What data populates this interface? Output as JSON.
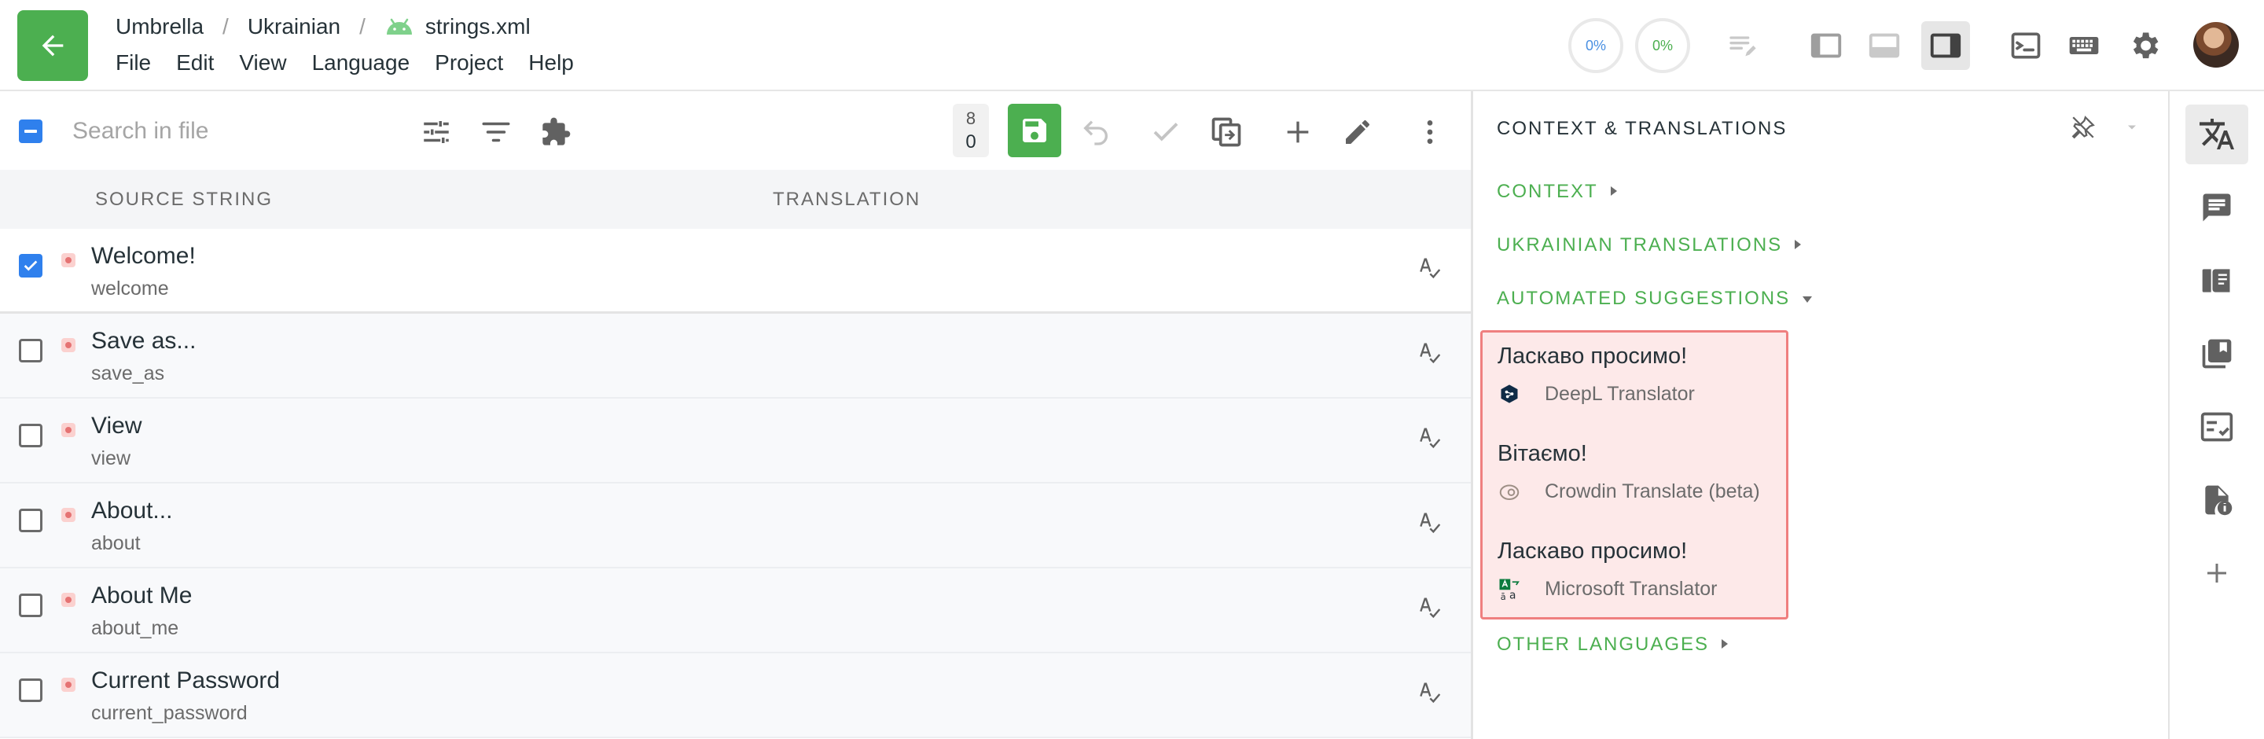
{
  "breadcrumb": {
    "project": "Umbrella",
    "separator": "/",
    "language": "Ukrainian",
    "file": "strings.xml"
  },
  "menu": [
    "File",
    "Edit",
    "View",
    "Language",
    "Project",
    "Help"
  ],
  "progress": {
    "translated": "0%",
    "approved": "0%"
  },
  "editor": {
    "search_placeholder": "Search in file",
    "counter_top": "8",
    "counter_bottom": "0",
    "columns": {
      "source": "SOURCE STRING",
      "translation": "TRANSLATION"
    },
    "rows": [
      {
        "text": "Welcome!",
        "key": "welcome",
        "checked": true
      },
      {
        "text": "Save as...",
        "key": "save_as",
        "checked": false
      },
      {
        "text": "View",
        "key": "view",
        "checked": false
      },
      {
        "text": "About...",
        "key": "about",
        "checked": false
      },
      {
        "text": "About Me",
        "key": "about_me",
        "checked": false
      },
      {
        "text": "Current Password",
        "key": "current_password",
        "checked": false
      }
    ]
  },
  "context": {
    "title": "CONTEXT & TRANSLATIONS",
    "sections": {
      "context": "CONTEXT",
      "ukrainian": "UKRAINIAN TRANSLATIONS",
      "automated": "AUTOMATED SUGGESTIONS",
      "other": "OTHER LANGUAGES"
    },
    "suggestions": [
      {
        "text": "Ласкаво просимо!",
        "source": "DeepL Translator",
        "icon": "deepl-icon"
      },
      {
        "text": "Вітаємо!",
        "source": "Crowdin Translate (beta)",
        "icon": "crowdin-icon"
      },
      {
        "text": "Ласкаво просимо!",
        "source": "Microsoft Translator",
        "icon": "microsoft-translator-icon"
      }
    ]
  },
  "colors": {
    "accent_green": "#4caf50",
    "checkbox_blue": "#2f80ed",
    "highlight_border": "#ef7f7f",
    "highlight_fill": "#fde9e9"
  }
}
